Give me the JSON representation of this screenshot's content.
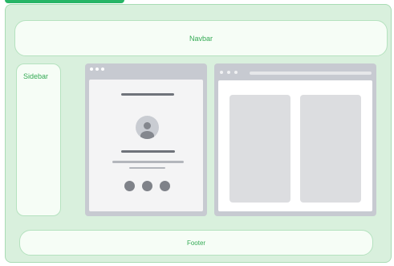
{
  "layout": {
    "navbar_label": "Navbar",
    "sidebar_label": "Sidebar",
    "footer_label": "Footer"
  },
  "colors": {
    "accent": "#27b566",
    "frame_background": "#d9f0dd",
    "region_background": "#f6fdf6",
    "label_text": "#35ab55",
    "window_chrome": "#c7cad1",
    "placeholder_dark": "#7f8289",
    "placeholder_light": "#dcdde0"
  },
  "icons": [
    "avatar-icon",
    "window-control-dot"
  ]
}
